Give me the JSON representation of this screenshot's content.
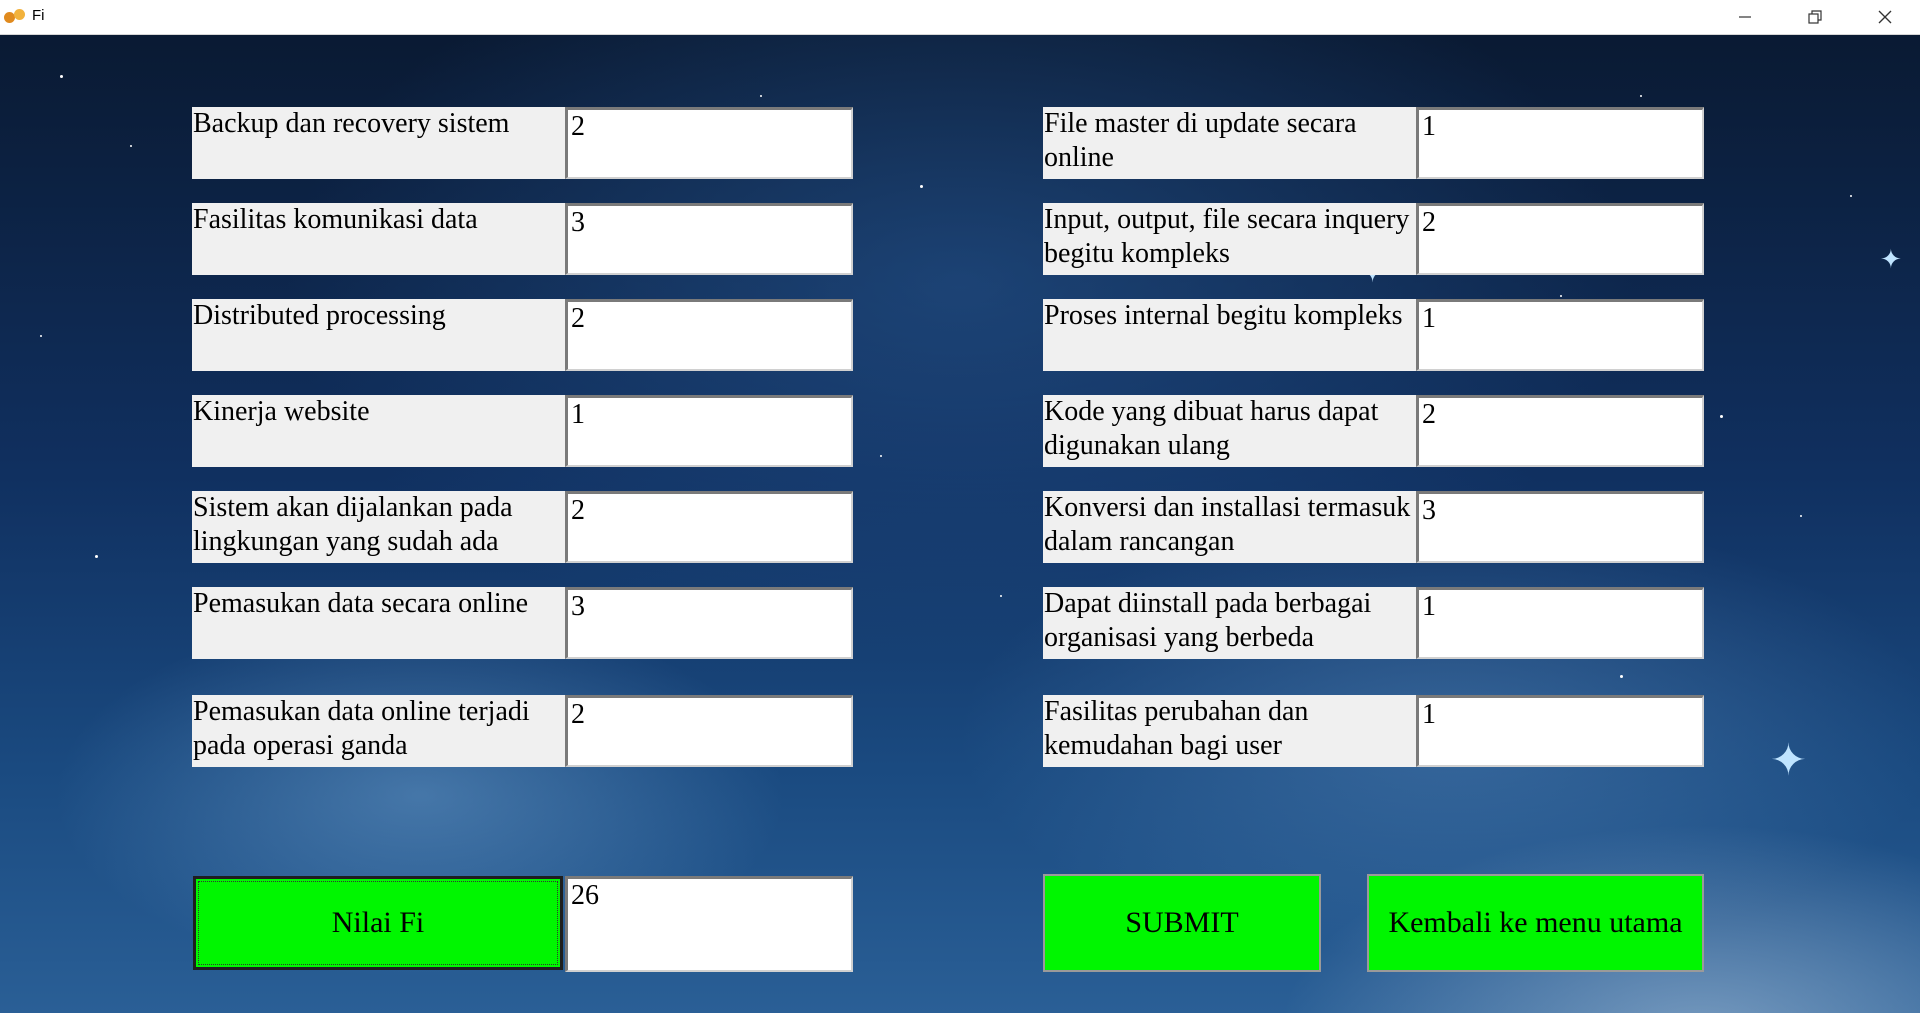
{
  "window": {
    "title": "Fi",
    "icon": "app-logo-icon",
    "controls": [
      "minimize-icon",
      "restore-icon",
      "close-icon"
    ]
  },
  "left_column": [
    {
      "label": "Backup dan recovery sistem",
      "value": "2"
    },
    {
      "label": "Fasilitas komunikasi data",
      "value": "3"
    },
    {
      "label": "Distributed processing",
      "value": "2"
    },
    {
      "label": "Kinerja website",
      "value": "1"
    },
    {
      "label": "Sistem akan dijalankan pada lingkungan yang sudah ada",
      "value": "2"
    },
    {
      "label": "Pemasukan data secara online",
      "value": "3"
    },
    {
      "label": "Pemasukan data online terjadi pada operasi ganda",
      "value": "2"
    }
  ],
  "right_column": [
    {
      "label": "File master di update secara online",
      "value": "1"
    },
    {
      "label": "Input, output, file secara inquery begitu kompleks",
      "value": "2"
    },
    {
      "label": "Proses internal begitu kompleks",
      "value": "1"
    },
    {
      "label": "Kode yang dibuat harus dapat digunakan ulang",
      "value": "2"
    },
    {
      "label": "Konversi dan installasi termasuk dalam rancangan",
      "value": "3"
    },
    {
      "label": "Dapat diinstall pada berbagai organisasi yang berbeda",
      "value": "1"
    },
    {
      "label": "Fasilitas perubahan dan kemudahan bagi user",
      "value": "1"
    }
  ],
  "actions": {
    "nilai_fi_label": "Nilai Fi",
    "nilai_fi_value": "26",
    "submit_label": "SUBMIT",
    "back_label": "Kembali ke menu utama"
  },
  "colors": {
    "button_green": "#00f600",
    "label_bg": "#f0f0f0"
  }
}
